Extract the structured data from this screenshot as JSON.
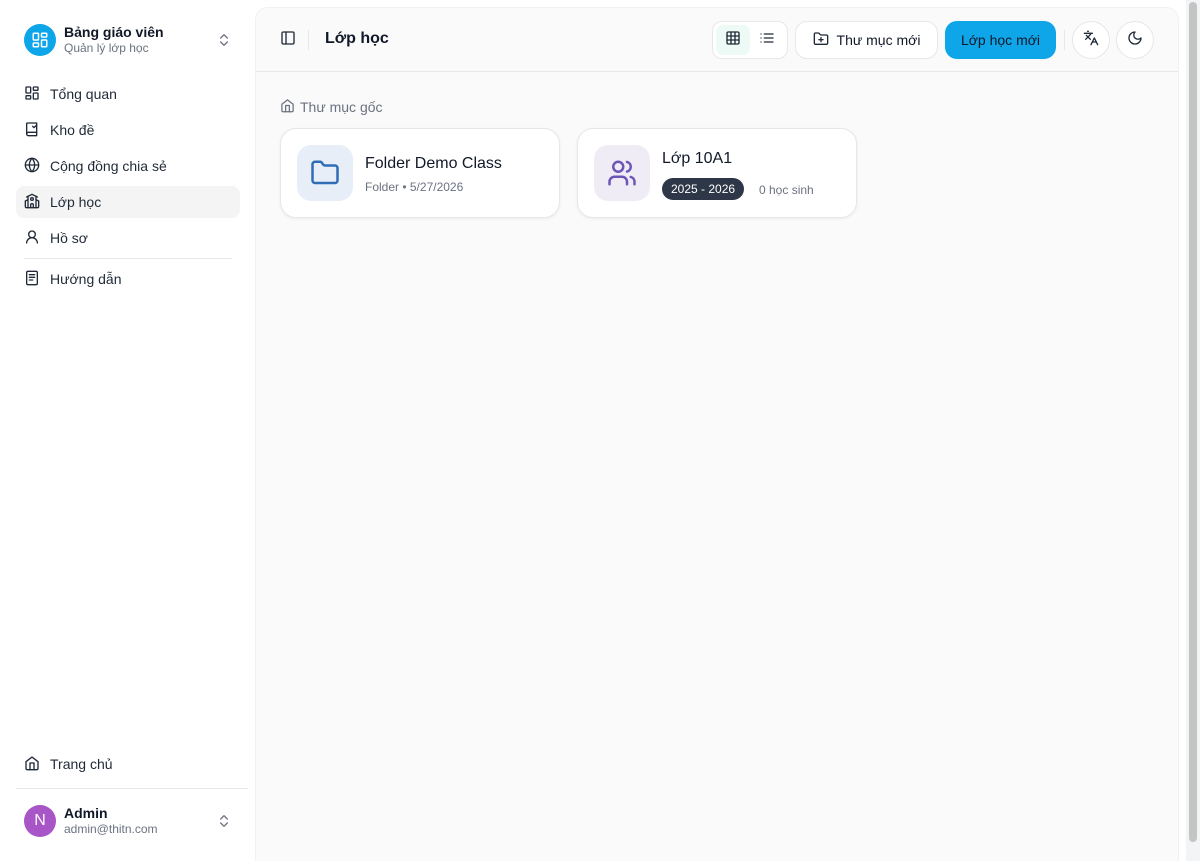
{
  "brand": {
    "title": "Bảng giáo viên",
    "subtitle": "Quản lý lớp học"
  },
  "sidebar": {
    "items": [
      {
        "label": "Tổng quan",
        "icon": "dashboard-icon"
      },
      {
        "label": "Kho đề",
        "icon": "book-icon"
      },
      {
        "label": "Cộng đồng chia sẻ",
        "icon": "globe-icon"
      },
      {
        "label": "Lớp học",
        "icon": "school-icon",
        "active": true
      },
      {
        "label": "Hồ sơ",
        "icon": "user-icon"
      },
      {
        "label": "Hướng dẫn",
        "icon": "document-icon"
      }
    ],
    "home_label": "Trang chủ"
  },
  "user": {
    "initial": "N",
    "name": "Admin",
    "email": "admin@thitn.com"
  },
  "header": {
    "title": "Lớp học",
    "new_folder_label": "Thư mục mới",
    "new_class_label": "Lớp học mới"
  },
  "breadcrumb": {
    "root_label": "Thư mục gốc"
  },
  "cards": {
    "folder": {
      "title": "Folder Demo Class",
      "meta": "Folder • 5/27/2026"
    },
    "class": {
      "title": "Lớp 10A1",
      "year": "2025 - 2026",
      "students": "0 học sinh"
    }
  },
  "colors": {
    "accent": "#0ea5e9",
    "avatar": "#a855c7",
    "badge": "#2d3748"
  }
}
